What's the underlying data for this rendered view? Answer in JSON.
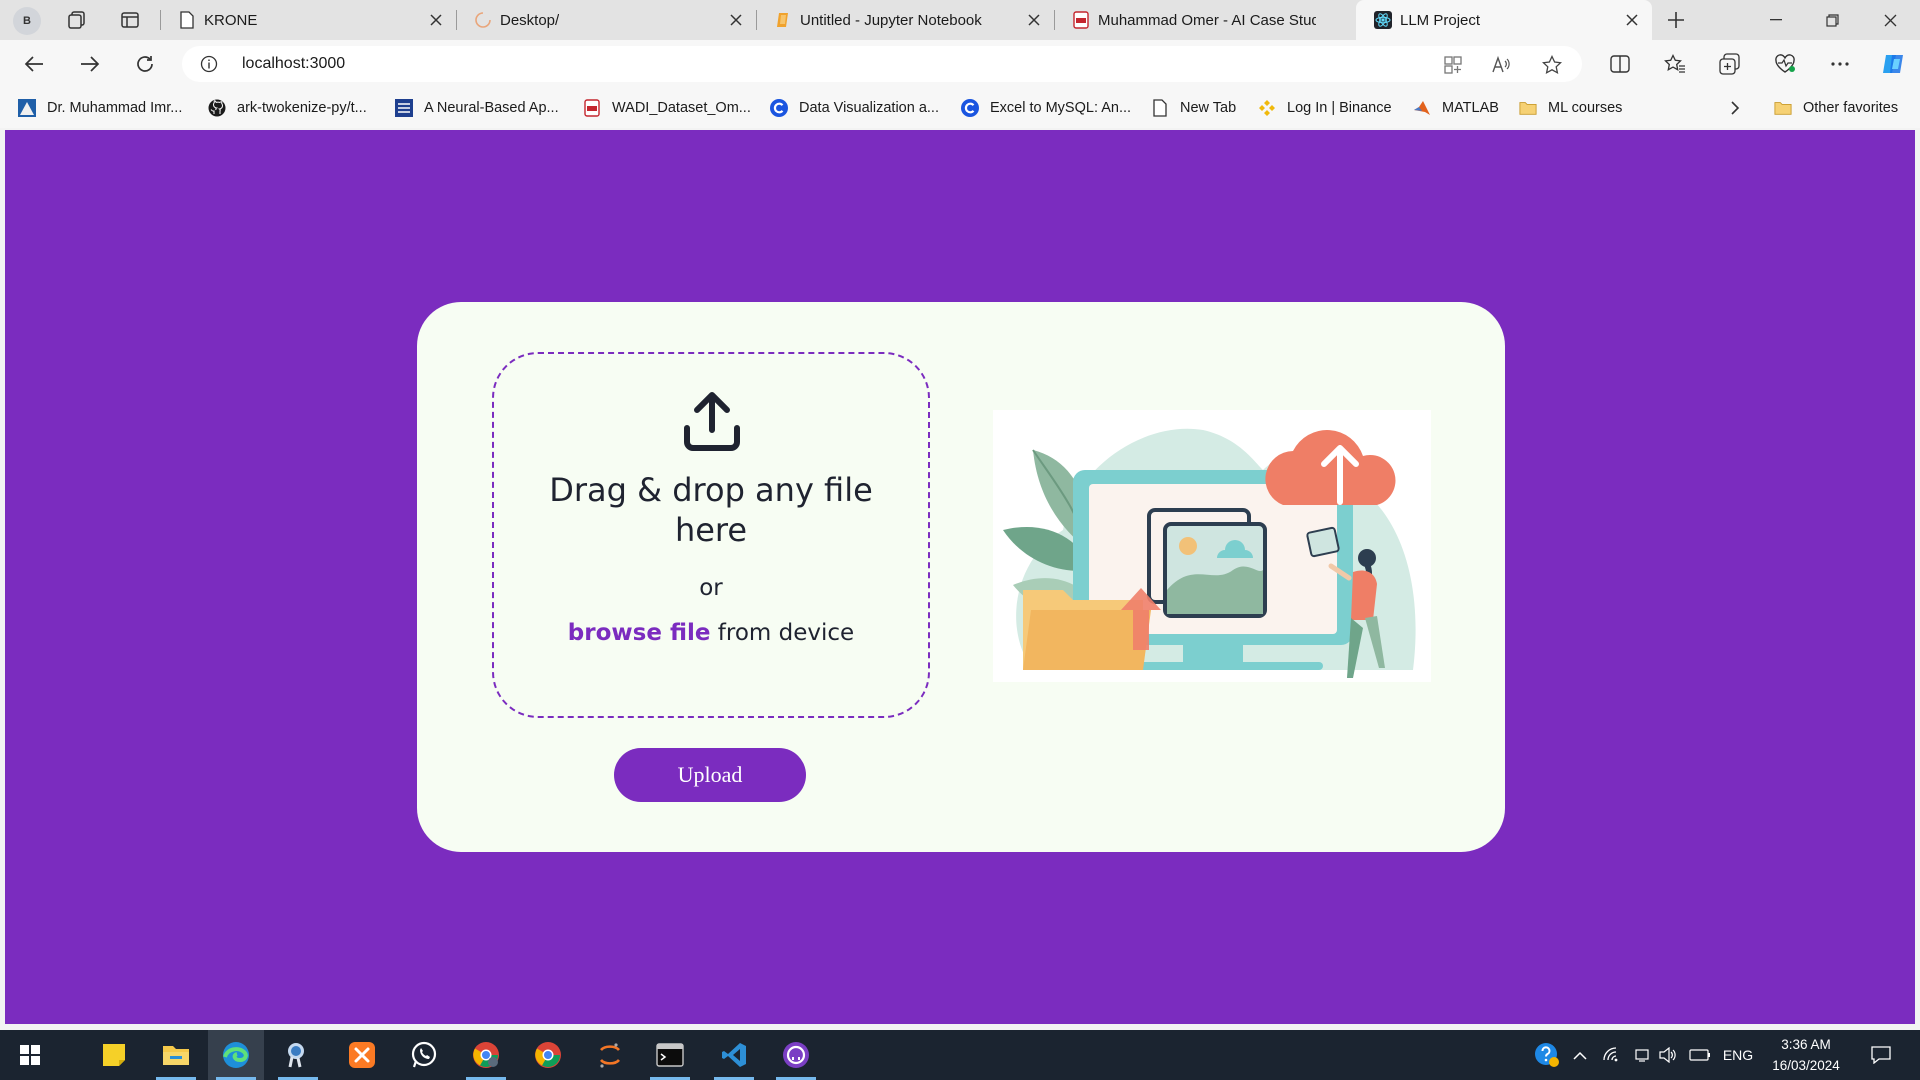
{
  "browser": {
    "profile_initial": "B",
    "tabs": [
      {
        "title": "KRONE",
        "icon": "page-icon"
      },
      {
        "title": "Desktop/",
        "icon": "loading-spinner-icon"
      },
      {
        "title": "Untitled - Jupyter Notebook",
        "icon": "jupyter-icon"
      },
      {
        "title": "Muhammad Omer - AI Case Stud",
        "icon": "pdf-icon"
      },
      {
        "title": "LLM Project",
        "icon": "react-icon",
        "active": true
      }
    ],
    "address": {
      "url": "localhost:3000"
    },
    "favorites": [
      {
        "label": "Dr. Muhammad Imr...",
        "icon": "site-icon"
      },
      {
        "label": "ark-twokenize-py/t...",
        "icon": "github-icon"
      },
      {
        "label": "A Neural-Based Ap...",
        "icon": "ieee-icon"
      },
      {
        "label": "WADI_Dataset_Om...",
        "icon": "pdf-icon"
      },
      {
        "label": "Data Visualization a...",
        "icon": "c-icon"
      },
      {
        "label": "Excel to MySQL: An...",
        "icon": "c-icon"
      },
      {
        "label": "New Tab",
        "icon": "page-icon"
      },
      {
        "label": "Log In | Binance",
        "icon": "binance-icon"
      },
      {
        "label": "MATLAB",
        "icon": "matlab-icon"
      },
      {
        "label": "ML courses",
        "icon": "folder-icon"
      }
    ],
    "other_favorites": "Other favorites"
  },
  "uploader": {
    "title": "Drag & drop any file here",
    "or_text": "or",
    "browse_link": "browse file",
    "browse_suffix": " from device",
    "upload_button": "Upload"
  },
  "taskbar": {
    "language": "ENG",
    "time": "3:36 AM",
    "date": "16/03/2024"
  },
  "colors": {
    "page_background": "#7b2cbf",
    "card_background": "#f7fdf3",
    "accent": "#7b2cbf"
  }
}
